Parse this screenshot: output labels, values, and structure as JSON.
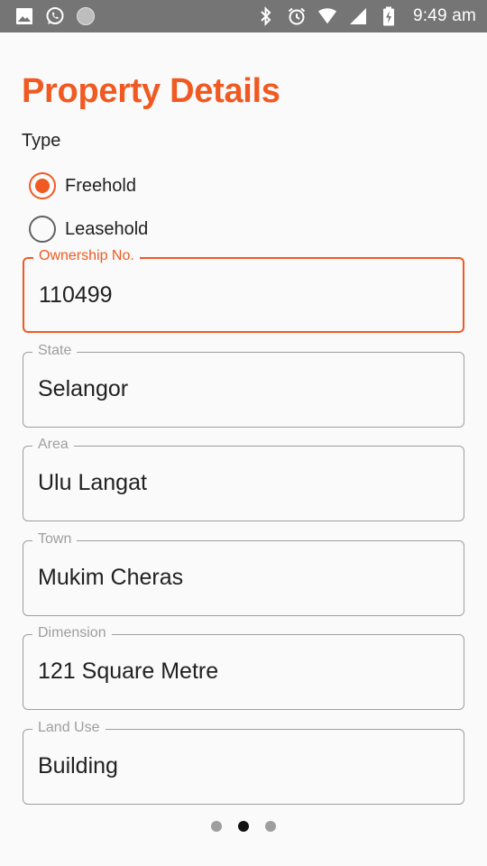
{
  "status_bar": {
    "time": "9:49 am",
    "left_icons": [
      "gallery-icon",
      "whatsapp-icon",
      "circle-icon"
    ],
    "right_icons": [
      "bluetooth-icon",
      "alarm-icon",
      "wifi-icon",
      "signal-icon",
      "battery-charging-icon"
    ],
    "background": "#757575"
  },
  "page": {
    "title": "Property Details",
    "accent_color": "#f05a22"
  },
  "type_section": {
    "label": "Type",
    "options": [
      {
        "label": "Freehold",
        "checked": true
      },
      {
        "label": "Leasehold",
        "checked": false
      }
    ]
  },
  "fields": [
    {
      "label": "Ownership No.",
      "value": "110499",
      "focused": true
    },
    {
      "label": "State",
      "value": "Selangor",
      "focused": false
    },
    {
      "label": "Area",
      "value": "Ulu Langat",
      "focused": false
    },
    {
      "label": "Town",
      "value": "Mukim Cheras",
      "focused": false
    },
    {
      "label": "Dimension",
      "value": "121 Square Metre",
      "focused": false
    },
    {
      "label": "Land Use",
      "value": "Building",
      "focused": false
    }
  ],
  "pager": {
    "total": 3,
    "current": 2
  }
}
